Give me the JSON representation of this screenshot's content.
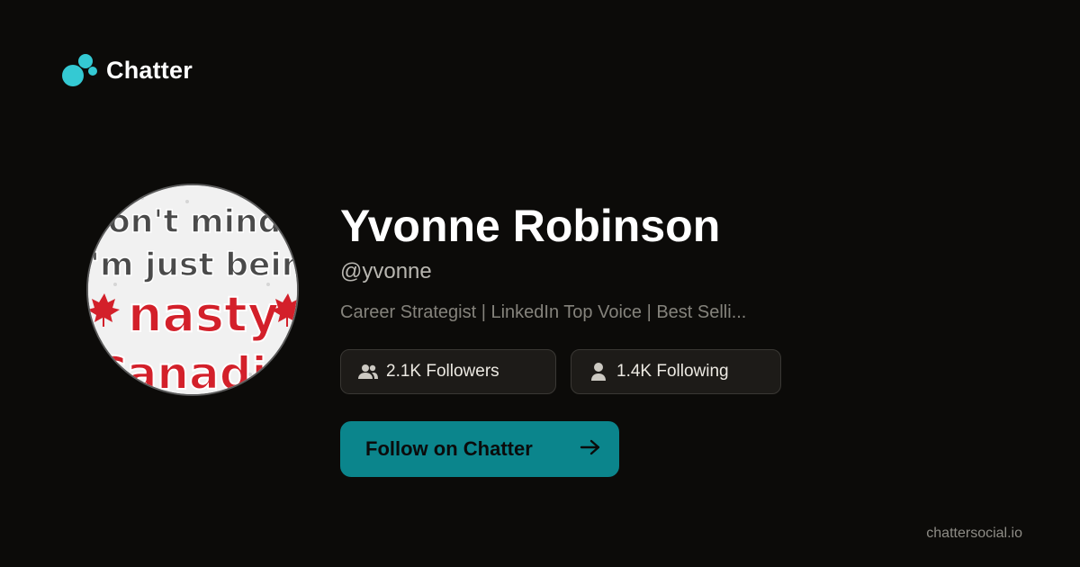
{
  "brand": {
    "name": "Chatter",
    "icon": "chatter-bubbles-icon",
    "accent": "#34c9d3"
  },
  "profile": {
    "name": "Yvonne Robinson",
    "handle": "@yvonne",
    "bio": "Career Strategist | LinkedIn Top Voice | Best Selli...",
    "avatar_text": [
      "on't mind m",
      "'m just being",
      "nasty",
      "Canadia"
    ]
  },
  "stats": {
    "followers": {
      "label": "2.1K Followers",
      "icon": "users-icon"
    },
    "following": {
      "label": "1.4K Following",
      "icon": "user-icon"
    }
  },
  "cta": {
    "label": "Follow on Chatter",
    "icon": "arrow-right-icon",
    "color": "#0b858c"
  },
  "footer": {
    "domain": "chattersocial.io"
  }
}
